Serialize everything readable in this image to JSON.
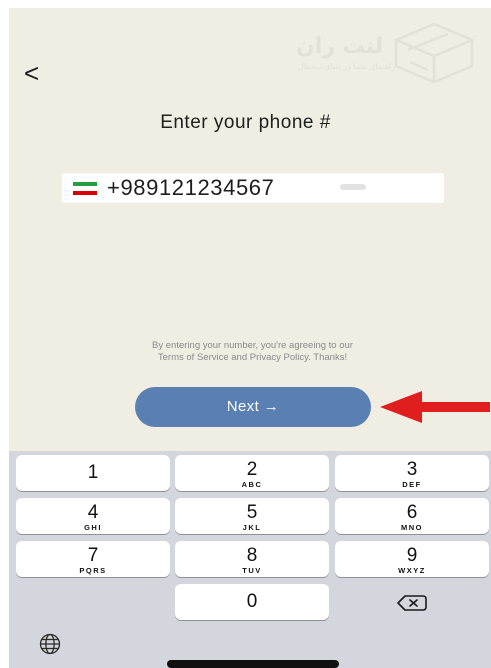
{
  "header": {
    "back_icon_glyph": "<",
    "watermark_text": "لنت ران",
    "watermark_subtext": "راهنمای شما در دنیای دیجیتال"
  },
  "page": {
    "title": "Enter your phone #"
  },
  "phone_input": {
    "country": "Iran",
    "flag_colors": [
      "#239f40",
      "#ffffff",
      "#da0000"
    ],
    "value": "+989121234567"
  },
  "terms": {
    "line1": "By entering your number, you're agreeing to our",
    "line2": "Terms of Service and Privacy Policy. Thanks!"
  },
  "next_button": {
    "label": "Next →",
    "color": "#5a7fb2"
  },
  "annotation": {
    "arrow_color": "#e01e1e"
  },
  "keypad": {
    "keys": [
      {
        "digit": "1",
        "letters": ""
      },
      {
        "digit": "2",
        "letters": "ABC"
      },
      {
        "digit": "3",
        "letters": "DEF"
      },
      {
        "digit": "4",
        "letters": "GHI"
      },
      {
        "digit": "5",
        "letters": "JKL"
      },
      {
        "digit": "6",
        "letters": "MNO"
      },
      {
        "digit": "7",
        "letters": "PQRS"
      },
      {
        "digit": "8",
        "letters": "TUV"
      },
      {
        "digit": "9",
        "letters": "WXYZ"
      },
      {
        "digit": "0",
        "letters": ""
      }
    ],
    "delete_icon": "backspace-icon",
    "globe_icon": "globe-icon"
  }
}
